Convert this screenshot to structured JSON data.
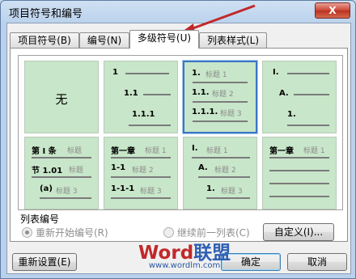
{
  "window": {
    "title": "项目符号和编号",
    "close_glyph": "X"
  },
  "tabs": [
    {
      "label": "项目符号(B)"
    },
    {
      "label": "编号(N)"
    },
    {
      "label": "多级符号(U)"
    },
    {
      "label": "列表样式(L)"
    }
  ],
  "active_tab": 2,
  "gallery": {
    "none_label": "无",
    "styles": [
      {
        "rows": [
          {
            "num": "1",
            "lbl": ""
          },
          {
            "num": "1.1",
            "lbl": ""
          },
          {
            "num": "1.1.1",
            "lbl": ""
          }
        ]
      },
      {
        "rows": [
          {
            "num": "1.",
            "lbl": "标题 1"
          },
          {
            "num": "1.1.",
            "lbl": "标题 2"
          },
          {
            "num": "1.1.1.",
            "lbl": "标题 3"
          }
        ]
      },
      {
        "rows": [
          {
            "num": "I.",
            "lbl": ""
          },
          {
            "num": "A.",
            "lbl": ""
          },
          {
            "num": "1.",
            "lbl": ""
          }
        ]
      },
      {
        "rows": [
          {
            "num": "第 I 条",
            "lbl": "标题"
          },
          {
            "num": "节 1.01",
            "lbl": "标题"
          },
          {
            "num": "(a)",
            "lbl": "标题 3"
          }
        ]
      },
      {
        "rows": [
          {
            "num": "第一章",
            "lbl": "标题 1"
          },
          {
            "num": "1-1",
            "lbl": "标题 2"
          },
          {
            "num": "1-1-1",
            "lbl": "标题 3"
          }
        ]
      },
      {
        "rows": [
          {
            "num": "I.",
            "lbl": "标题 1"
          },
          {
            "num": "A.",
            "lbl": "标题 2"
          },
          {
            "num": "1.",
            "lbl": "标题 3"
          }
        ]
      },
      {
        "rows": [
          {
            "num": "第一章",
            "lbl": "标题 1"
          },
          {
            "num": "",
            "lbl": ""
          },
          {
            "num": "",
            "lbl": ""
          }
        ]
      }
    ],
    "selected_index": 2
  },
  "list_numbering": {
    "label": "列表编号",
    "restart_label": "重新开始编号(R)",
    "continue_label": "继续前一列表(C)",
    "selected": "restart"
  },
  "buttons": {
    "customize": "自定义(I)...",
    "reset": "重新设置(E)",
    "ok": "确定",
    "cancel": "取消"
  },
  "watermark": {
    "brand_latin": "Word",
    "brand_cn": "联盟",
    "url": "www.wordlm.com"
  },
  "colors": {
    "cell_bg": "#c8e6c9",
    "selection_border": "#3a76c4",
    "arrow": "#c0292b"
  }
}
